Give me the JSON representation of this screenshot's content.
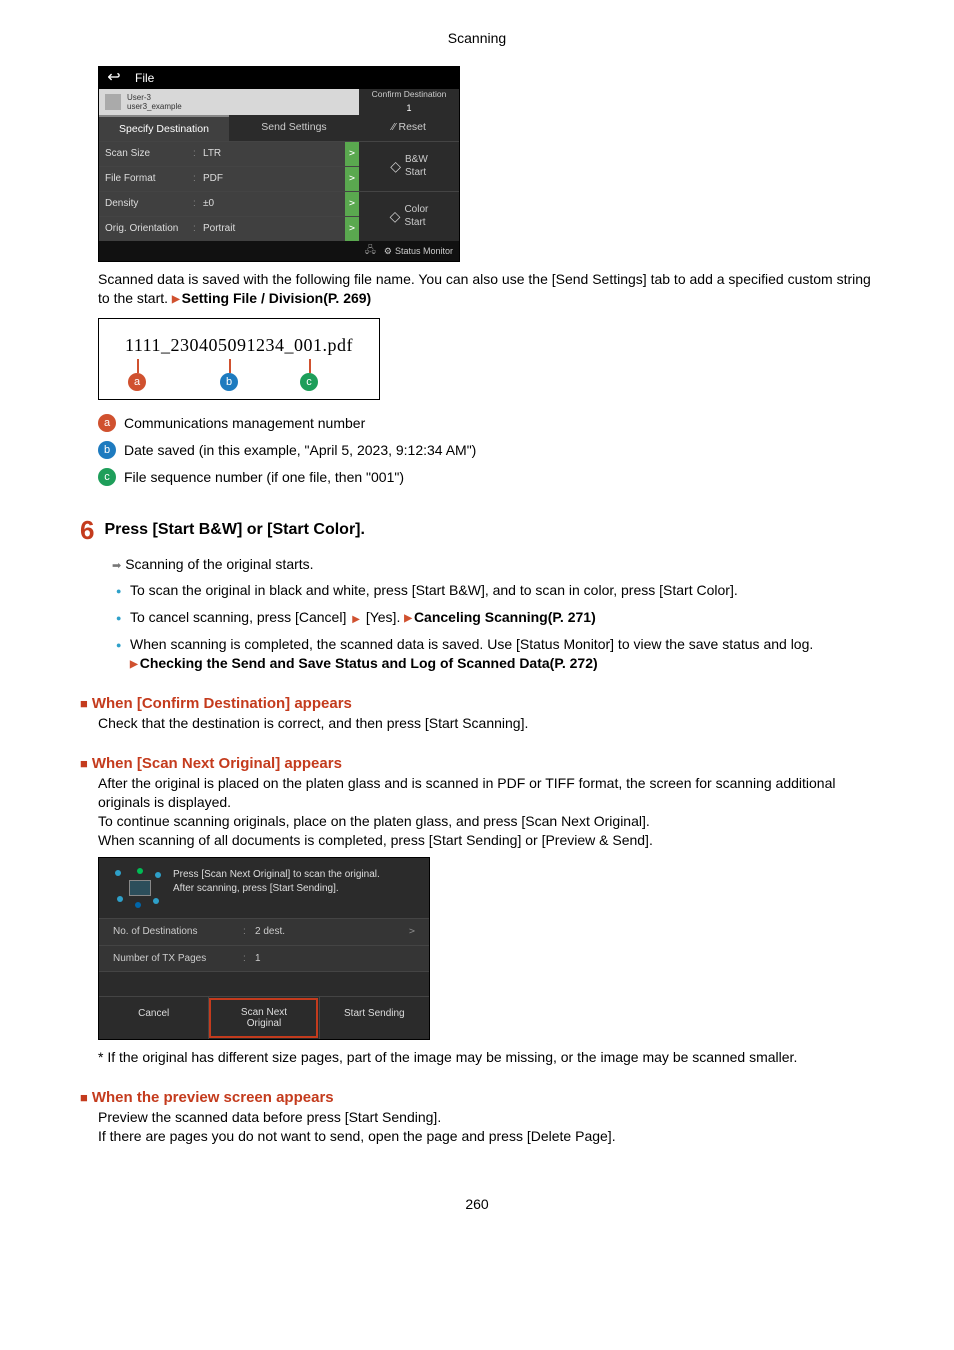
{
  "header": "Scanning",
  "page_number": "260",
  "device1": {
    "title": "File",
    "user_top": "User-3",
    "user_bottom": "user3_example",
    "confirm_dest": "Confirm Destination",
    "confirm_count": "1",
    "tab_specify": "Specify Destination",
    "tab_send": "Send Settings",
    "reset": "Reset",
    "rows": {
      "scan_size": {
        "label": "Scan Size",
        "value": "LTR"
      },
      "file_format": {
        "label": "File Format",
        "value": "PDF"
      },
      "density": {
        "label": "Density",
        "value": "±0"
      },
      "orientation": {
        "label": "Orig. Orientation",
        "value": "Portrait"
      }
    },
    "bw_start": "B&W\nStart",
    "color_start": "Color\nStart",
    "status_monitor": "Status Monitor"
  },
  "para1_a": "Scanned data is saved with the following file name. You can also use the [Send Settings] tab to add a specified custom string to the start. ",
  "para1_link": "Setting File / Division(P. 269)",
  "filename_diagram": {
    "text": "1111_230405091234_001.pdf"
  },
  "callout_a": "Communications management number",
  "callout_b": "Date saved (in this example, \"April 5, 2023, 9:12:34 AM\")",
  "callout_c": "File sequence number (if one file, then \"001\")",
  "step6_title": "Press [Start B&W] or [Start Color].",
  "step6_arrow": "Scanning of the original starts.",
  "step6_bullets": {
    "b1": "To scan the original in black and white, press [Start B&W], and to scan in color, press [Start Color].",
    "b2_a": "To cancel scanning, press [Cancel] ",
    "b2_b": " [Yes]. ",
    "b2_link": "Canceling Scanning(P. 271)",
    "b3_a": "When scanning is completed, the scanned data is saved. Use [Status Monitor] to view the save status and log.",
    "b3_link": "Checking the Send and Save Status and Log of Scanned Data(P. 272)"
  },
  "confirm_hd": "When [Confirm Destination] appears",
  "confirm_body": "Check that the destination is correct, and then press [Start Scanning].",
  "scan_next_hd": "When [Scan Next Original] appears",
  "scan_next_body1": "After the original is placed on the platen glass and is scanned in PDF or TIFF format, the screen for scanning additional originals is displayed.",
  "scan_next_body2": "To continue scanning originals, place on the platen glass, and press [Scan Next Original].",
  "scan_next_body3": "When scanning of all documents is completed, press [Start Sending] or [Preview & Send].",
  "device2": {
    "msg1": "Press [Scan Next Original] to scan the original.",
    "msg2": "After scanning, press [Start Sending].",
    "dest_label": "No. of Destinations",
    "dest_value": "2 dest.",
    "tx_label": "Number of TX Pages",
    "tx_value": "1",
    "btn_cancel": "Cancel",
    "btn_scan_next": "Scan Next\nOriginal",
    "btn_start_sending": "Start Sending"
  },
  "size_note": "* If the original has different size pages, part of the image may be missing, or the image may be scanned smaller.",
  "preview_hd": "When the preview screen appears",
  "preview_body1": "Preview the scanned data before press [Start Sending].",
  "preview_body2": "If there are pages you do not want to send, open the page and press [Delete Page]."
}
